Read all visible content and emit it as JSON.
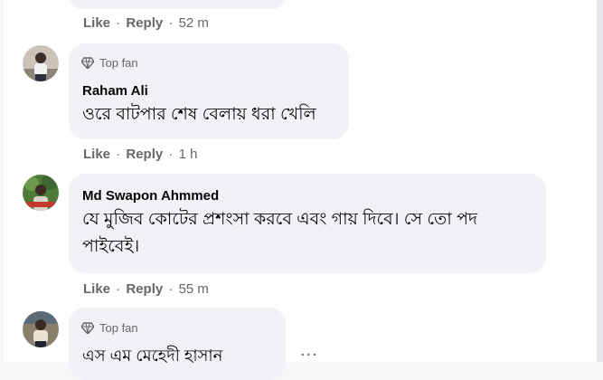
{
  "comments": [
    {
      "actions": {
        "like": "Like",
        "reply": "Reply",
        "time": "52 m"
      }
    },
    {
      "badge": "Top fan",
      "author": "Raham Ali",
      "text": "ওরে বাটপার শেষ বেলায় ধরা খেলি",
      "actions": {
        "like": "Like",
        "reply": "Reply",
        "time": "1 h"
      }
    },
    {
      "author": "Md Swapon Ahmmed",
      "text_line1": "যে মুজিব কোটের প্রশংসা করবে এবং গায় দিবে। সে তো পদ",
      "text_line2": "পাইবেই।",
      "actions": {
        "like": "Like",
        "reply": "Reply",
        "time": "55 m"
      }
    },
    {
      "badge": "Top fan",
      "author": "এস এম মেহেদী হাসান",
      "more": "..."
    }
  ],
  "icons": {
    "badge": "diamond-icon",
    "more": "more-options-icon"
  }
}
